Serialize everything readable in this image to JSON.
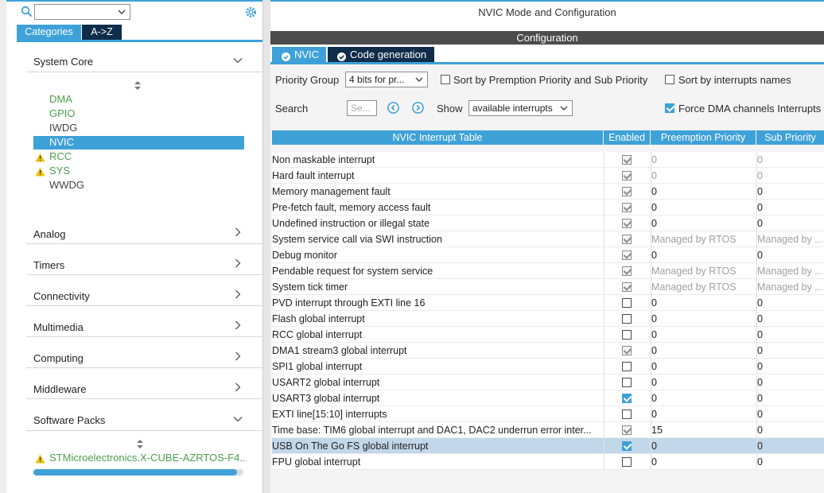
{
  "left": {
    "tabs": {
      "categories": "Categories",
      "az": "A->Z"
    },
    "categories": [
      {
        "label": "System Core",
        "expanded": true
      },
      {
        "label": "Analog",
        "expanded": false
      },
      {
        "label": "Timers",
        "expanded": false
      },
      {
        "label": "Connectivity",
        "expanded": false
      },
      {
        "label": "Multimedia",
        "expanded": false
      },
      {
        "label": "Computing",
        "expanded": false
      },
      {
        "label": "Middleware",
        "expanded": false
      },
      {
        "label": "Software Packs",
        "expanded": true
      }
    ],
    "system_core_items": [
      {
        "label": "DMA",
        "status": "configured"
      },
      {
        "label": "GPIO",
        "status": "configured"
      },
      {
        "label": "IWDG",
        "status": "none"
      },
      {
        "label": "NVIC",
        "status": "selected"
      },
      {
        "label": "RCC",
        "status": "warning"
      },
      {
        "label": "SYS",
        "status": "warning"
      },
      {
        "label": "WWDG",
        "status": "none"
      }
    ],
    "software_pack_item": "STMicroelectronics.X-CUBE-AZRTOS-F4...",
    "software_pack_progress": 0.97
  },
  "right": {
    "title": "NVIC Mode and Configuration",
    "config_bar": "Configuration",
    "tabs": {
      "nvic": "NVIC",
      "codegen": "Code generation"
    },
    "priority_group_label": "Priority Group",
    "priority_group_value": "4 bits for pr...",
    "sort_preemption_label": "Sort by Premption Priority and Sub Priority",
    "sort_names_label": "Sort by interrupts names",
    "search_label": "Search",
    "search_placeholder": "Se...",
    "show_label": "Show",
    "show_value": "available interrupts",
    "force_dma_label": "Force DMA channels Interrupts",
    "table_headers": {
      "name": "NVIC Interrupt Table",
      "enabled": "Enabled",
      "preemption": "Preemption Priority",
      "sub": "Sub Priority"
    },
    "rows": [
      {
        "name": "Non maskable interrupt",
        "enabled": "fixed",
        "pre": "0",
        "sub": "0",
        "muted": true
      },
      {
        "name": "Hard fault interrupt",
        "enabled": "fixed",
        "pre": "0",
        "sub": "0",
        "muted": true
      },
      {
        "name": "Memory management fault",
        "enabled": "fixed",
        "pre": "0",
        "sub": "0",
        "muted": false
      },
      {
        "name": "Pre-fetch fault, memory access fault",
        "enabled": "fixed",
        "pre": "0",
        "sub": "0",
        "muted": false
      },
      {
        "name": "Undefined instruction or illegal state",
        "enabled": "fixed",
        "pre": "0",
        "sub": "0",
        "muted": false
      },
      {
        "name": "System service call via SWI instruction",
        "enabled": "fixed",
        "pre": "Managed by RTOS",
        "sub": "Managed by ...",
        "muted": true
      },
      {
        "name": "Debug monitor",
        "enabled": "fixed",
        "pre": "0",
        "sub": "0",
        "muted": false
      },
      {
        "name": "Pendable request for system service",
        "enabled": "fixed",
        "pre": "Managed by RTOS",
        "sub": "Managed by ...",
        "muted": true
      },
      {
        "name": "System tick timer",
        "enabled": "fixed",
        "pre": "Managed by RTOS",
        "sub": "Managed by ...",
        "muted": true
      },
      {
        "name": "PVD interrupt through EXTI line 16",
        "enabled": "off",
        "pre": "0",
        "sub": "0",
        "muted": false
      },
      {
        "name": "Flash global interrupt",
        "enabled": "off",
        "pre": "0",
        "sub": "0",
        "muted": false
      },
      {
        "name": "RCC global interrupt",
        "enabled": "off",
        "pre": "0",
        "sub": "0",
        "muted": false
      },
      {
        "name": "DMA1 stream3 global interrupt",
        "enabled": "fixed",
        "pre": "0",
        "sub": "0",
        "muted": false
      },
      {
        "name": "SPI1 global interrupt",
        "enabled": "off",
        "pre": "0",
        "sub": "0",
        "muted": false
      },
      {
        "name": "USART2 global interrupt",
        "enabled": "off",
        "pre": "0",
        "sub": "0",
        "muted": false
      },
      {
        "name": "USART3 global interrupt",
        "enabled": "on",
        "pre": "0",
        "sub": "0",
        "muted": false
      },
      {
        "name": "EXTI line[15:10] interrupts",
        "enabled": "off",
        "pre": "0",
        "sub": "0",
        "muted": false
      },
      {
        "name": "Time base: TIM6 global interrupt and DAC1, DAC2 underrun error inter...",
        "enabled": "fixed",
        "pre": "15",
        "sub": "0",
        "muted": false
      },
      {
        "name": "USB On The Go FS global interrupt",
        "enabled": "on",
        "pre": "0",
        "sub": "0",
        "muted": false,
        "selected": true
      },
      {
        "name": "FPU global interrupt",
        "enabled": "off",
        "pre": "0",
        "sub": "0",
        "muted": false
      }
    ]
  },
  "colors": {
    "accent": "#3ea1d8",
    "dark_tab": "#0f2d4a",
    "config_bar": "#4c4c4c",
    "configured": "#4a9f4a",
    "warning": "#f2c200",
    "selected_row": "#c3d7ea"
  }
}
